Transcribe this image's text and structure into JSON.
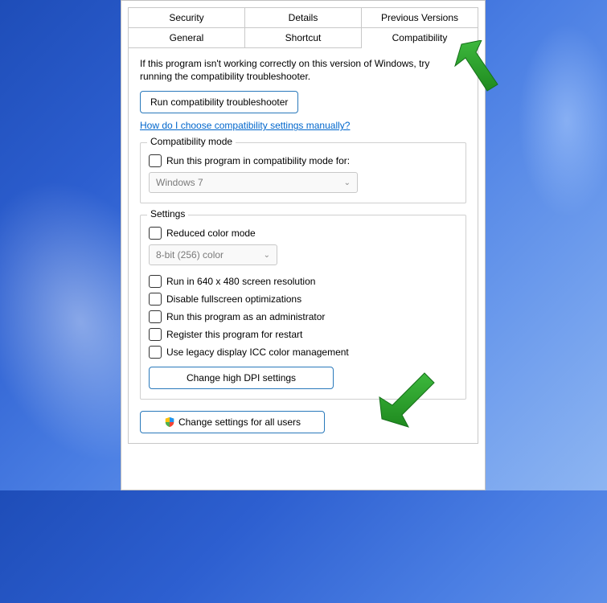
{
  "tabs": {
    "row1": [
      "Security",
      "Details",
      "Previous Versions"
    ],
    "row2": [
      "General",
      "Shortcut",
      "Compatibility"
    ],
    "active": "Compatibility"
  },
  "intro_line1": "If this program isn't working correctly on this version of Windows, try",
  "intro_line2": "running the compatibility troubleshooter.",
  "btn_troubleshoot": "Run compatibility troubleshooter",
  "link_help": "How do I choose compatibility settings manually?",
  "compat_mode": {
    "title": "Compatibility mode",
    "checkbox": "Run this program in compatibility mode for:",
    "select_value": "Windows 7"
  },
  "settings": {
    "title": "Settings",
    "reduced_color": "Reduced color mode",
    "color_value": "8-bit (256) color",
    "run_640": "Run in 640 x 480 screen resolution",
    "disable_fullscreen": "Disable fullscreen optimizations",
    "run_admin": "Run this program as an administrator",
    "register_restart": "Register this program for restart",
    "legacy_icc": "Use legacy display ICC color management",
    "btn_dpi": "Change high DPI settings"
  },
  "btn_all_users": "Change settings for all users"
}
